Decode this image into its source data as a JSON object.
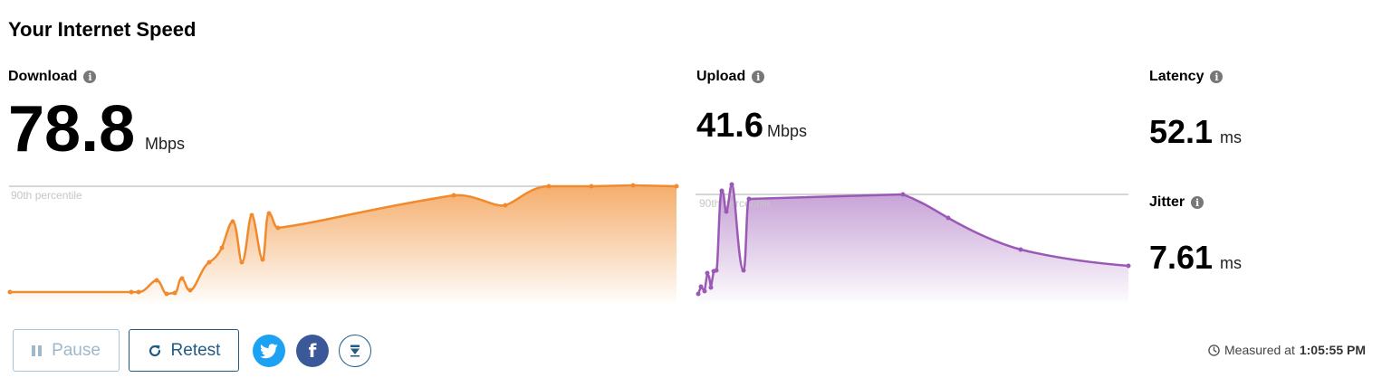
{
  "title": "Your Internet Speed",
  "download": {
    "label": "Download",
    "value": "78.8",
    "unit": "Mbps",
    "percentile_label": "90th percentile",
    "color": "#f08a2c"
  },
  "upload": {
    "label": "Upload",
    "value": "41.6",
    "unit": "Mbps",
    "percentile_label": "90th percentile",
    "color": "#9b59b6"
  },
  "latency": {
    "label": "Latency",
    "value": "52.1",
    "unit": "ms"
  },
  "jitter": {
    "label": "Jitter",
    "value": "7.61",
    "unit": "ms"
  },
  "buttons": {
    "pause": "Pause",
    "retest": "Retest"
  },
  "icons": {
    "info": "info-icon",
    "pause": "pause-icon",
    "retest": "refresh-icon",
    "twitter": "twitter-icon",
    "facebook": "facebook-icon",
    "download": "download-icon",
    "clock": "clock-icon"
  },
  "measured": {
    "prefix": "Measured at",
    "time": "1:05:55 PM"
  }
}
